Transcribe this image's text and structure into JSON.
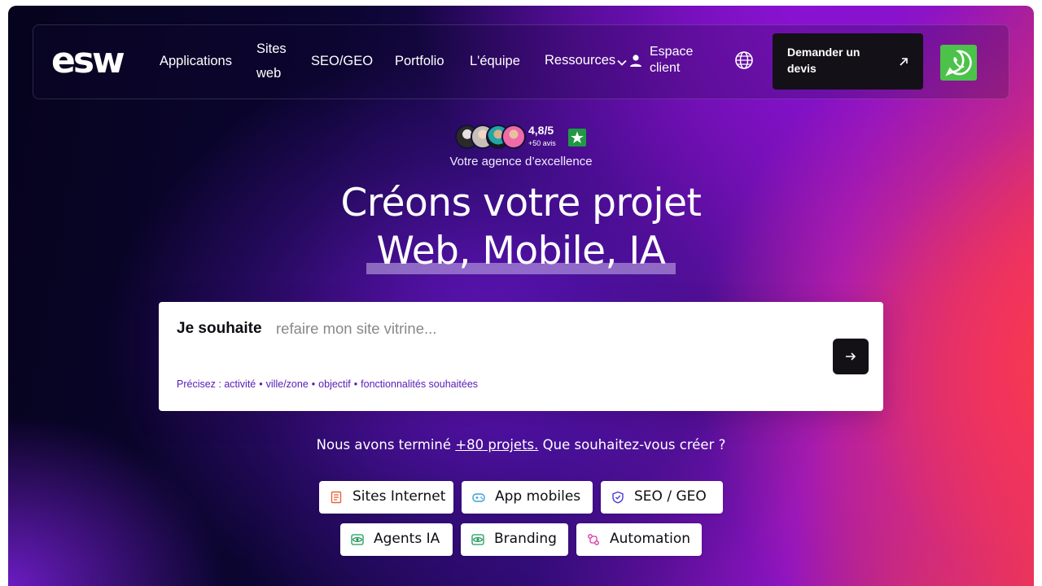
{
  "nav": {
    "logo_text": "esw",
    "links": [
      {
        "label": "Applications"
      },
      {
        "label_line1": "Sites",
        "label_line2": "web"
      },
      {
        "label": "SEO/GEO"
      },
      {
        "label": "Portfolio"
      },
      {
        "label": "L'équipe"
      },
      {
        "label": "Ressources"
      }
    ],
    "account_line1": "Espace",
    "account_line2": "client",
    "quote_button": "Demander un devis",
    "icons": [
      "chevron-down-icon",
      "user-icon",
      "globe-icon",
      "arrow-up-right-icon",
      "whatsapp-icon"
    ]
  },
  "rating": {
    "score": "4,8/5",
    "count": "+50 avis",
    "tagline": "Votre agence d’excellence",
    "badge_icon": "trustpilot-star-icon"
  },
  "hero": {
    "line1": "Créons votre projet",
    "line2": "Web, Mobile, IA"
  },
  "search": {
    "prefix": "Je souhaite",
    "placeholder": "refaire mon site vitrine...",
    "hints": [
      "Précisez : activité",
      "ville/zone",
      "objectif",
      "fonctionnalités souhaitées"
    ],
    "hint_separator": "•",
    "submit_icon": "arrow-right-icon"
  },
  "projects": {
    "before": "Nous avons terminé",
    "link": "+80 projets.",
    "after": "Que souhaitez-vous créer ?"
  },
  "chips": [
    {
      "label": "Sites Internet",
      "icon": "document-icon",
      "color": "#e8623a"
    },
    {
      "label": "App mobiles",
      "icon": "gamepad-icon",
      "color": "#3aa0d8"
    },
    {
      "label": "SEO / GEO",
      "icon": "shield-icon",
      "color": "#4a3ad8"
    },
    {
      "label": "Agents IA",
      "icon": "eye-icon",
      "color": "#1f9a5a"
    },
    {
      "label": "Branding",
      "icon": "eye-icon",
      "color": "#1f9a5a"
    },
    {
      "label": "Automation",
      "icon": "workflow-icon",
      "color": "#d83aa8"
    }
  ],
  "colors": {
    "accent_dark": "#141018",
    "whatsapp_green": "#4cc24a",
    "trustpilot_green": "#1f9a43",
    "hint_purple": "#5a18b8"
  }
}
